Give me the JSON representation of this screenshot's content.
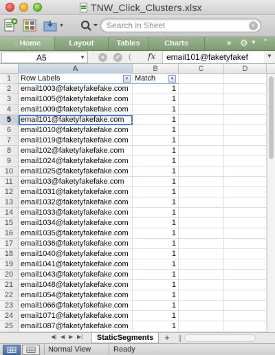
{
  "window": {
    "title": "TNW_Click_Clusters.xlsx"
  },
  "toolbar": {
    "search_placeholder": "Search in Sheet"
  },
  "ribbon": {
    "tabs": [
      "Home",
      "Layout",
      "Tables",
      "Charts"
    ],
    "more_label": "»"
  },
  "formula_bar": {
    "name_box": "A5",
    "fx_label": "fx",
    "content": "email101@faketyfakef"
  },
  "grid": {
    "columns": [
      "A",
      "B",
      "C",
      "D"
    ],
    "active_column": "A",
    "active_row": 5,
    "header": {
      "row_labels": "Row Labels",
      "match": "Match"
    },
    "rows": [
      {
        "n": "1"
      },
      {
        "n": "2",
        "email": "email1003@faketyfakefake.com",
        "match": "1"
      },
      {
        "n": "3",
        "email": "email1005@faketyfakefake.com",
        "match": "1"
      },
      {
        "n": "4",
        "email": "email1009@faketyfakefake.com",
        "match": "1"
      },
      {
        "n": "5",
        "email": "email101@faketyfakefake.com",
        "match": "1"
      },
      {
        "n": "6",
        "email": "email1010@faketyfakefake.com",
        "match": "1"
      },
      {
        "n": "7",
        "email": "email1019@faketyfakefake.com",
        "match": "1"
      },
      {
        "n": "8",
        "email": "email102@faketyfakefake.com",
        "match": "1"
      },
      {
        "n": "9",
        "email": "email1024@faketyfakefake.com",
        "match": "1"
      },
      {
        "n": "10",
        "email": "email1025@faketyfakefake.com",
        "match": "1"
      },
      {
        "n": "11",
        "email": "email103@faketyfakefake.com",
        "match": "1"
      },
      {
        "n": "12",
        "email": "email1031@faketyfakefake.com",
        "match": "1"
      },
      {
        "n": "13",
        "email": "email1032@faketyfakefake.com",
        "match": "1"
      },
      {
        "n": "14",
        "email": "email1033@faketyfakefake.com",
        "match": "1"
      },
      {
        "n": "15",
        "email": "email1034@faketyfakefake.com",
        "match": "1"
      },
      {
        "n": "16",
        "email": "email1035@faketyfakefake.com",
        "match": "1"
      },
      {
        "n": "17",
        "email": "email1036@faketyfakefake.com",
        "match": "1"
      },
      {
        "n": "18",
        "email": "email1040@faketyfakefake.com",
        "match": "1"
      },
      {
        "n": "19",
        "email": "email1041@faketyfakefake.com",
        "match": "1"
      },
      {
        "n": "20",
        "email": "email1043@faketyfakefake.com",
        "match": "1"
      },
      {
        "n": "21",
        "email": "email1048@faketyfakefake.com",
        "match": "1"
      },
      {
        "n": "22",
        "email": "email1054@faketyfakefake.com",
        "match": "1"
      },
      {
        "n": "23",
        "email": "email1066@faketyfakefake.com",
        "match": "1"
      },
      {
        "n": "24",
        "email": "email1071@faketyfakefake.com",
        "match": "1"
      },
      {
        "n": "25",
        "email": "email1087@faketyfakefake.com",
        "match": "1"
      }
    ]
  },
  "sheets": {
    "tabs": [
      "StaticSegments"
    ],
    "add_label": "+"
  },
  "status": {
    "view": "Normal View",
    "state": "Ready"
  },
  "colors": {
    "ribbon": "#8eaa82",
    "selection": "#3f74c8"
  }
}
